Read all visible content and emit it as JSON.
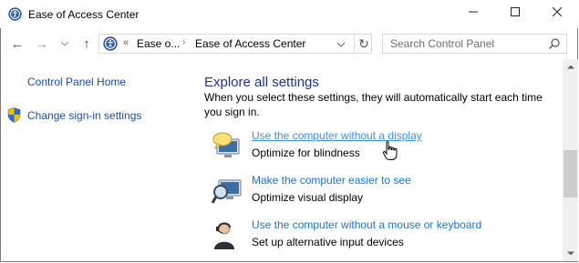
{
  "window": {
    "title": "Ease of Access Center",
    "icons": {
      "app": "ease-of-access-icon",
      "minimize": "minimize-icon",
      "maximize": "maximize-icon",
      "close": "close-icon"
    }
  },
  "nav": {
    "back": "←",
    "forward": "→",
    "recent": "⌄",
    "up": "↑",
    "address": {
      "overflow": "«",
      "crumbs": [
        "Ease o...",
        "Ease of Access Center"
      ],
      "separator": "›"
    },
    "refresh": "↻",
    "search_placeholder": "Search Control Panel"
  },
  "left_pane": {
    "home_link": "Control Panel Home",
    "signin_link": "Change sign-in settings"
  },
  "main": {
    "heading": "Explore all settings",
    "description": "When you select these settings, they will automatically start each time you sign in.",
    "items": [
      {
        "link": "Use the computer without a display",
        "sub": "Optimize for blindness",
        "icon": "speech-bubble-monitor-icon",
        "hovered": true
      },
      {
        "link": "Make the computer easier to see",
        "sub": "Optimize visual display",
        "icon": "magnifier-monitor-icon",
        "hovered": false
      },
      {
        "link": "Use the computer without a mouse or keyboard",
        "sub": "Set up alternative input devices",
        "icon": "person-headset-icon",
        "hovered": false
      }
    ]
  },
  "colors": {
    "link": "#1a73c7",
    "heading": "#1e3287",
    "left_link": "#1a4ca1"
  }
}
